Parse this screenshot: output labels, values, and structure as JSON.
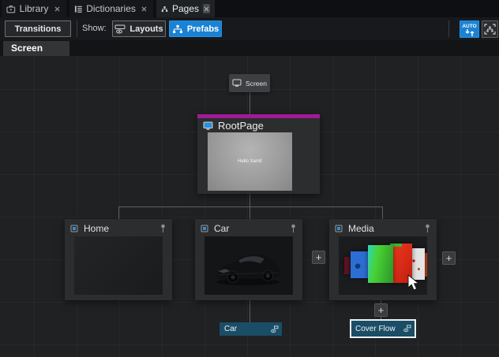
{
  "window": {
    "tabs": [
      {
        "label": "Library"
      },
      {
        "label": "Dictionaries"
      },
      {
        "label": "Pages"
      }
    ]
  },
  "toolbar": {
    "transitions": "Transitions",
    "show": "Show:",
    "layouts": "Layouts",
    "prefabs": "Prefabs",
    "auto": "AUTO"
  },
  "breadcrumb": {
    "screen": "Screen"
  },
  "graph": {
    "screen_badge": "Screen",
    "rootpage": {
      "title": "RootPage",
      "preview_text": "Hello Xaml!"
    },
    "nodes": [
      {
        "title": "Home"
      },
      {
        "title": "Car"
      },
      {
        "title": "Media"
      }
    ],
    "plus": "+",
    "car_bar": {
      "label": "Car"
    },
    "coverflow_bar": {
      "label": "Cover Flow"
    }
  },
  "colors": {
    "accent_blue": "#1a82d4",
    "rootpage_accent": "#a21a96",
    "bar_blue": "#1b4d66",
    "canvas_bg": "#1f2123",
    "node_bg": "#2b2d2f"
  }
}
